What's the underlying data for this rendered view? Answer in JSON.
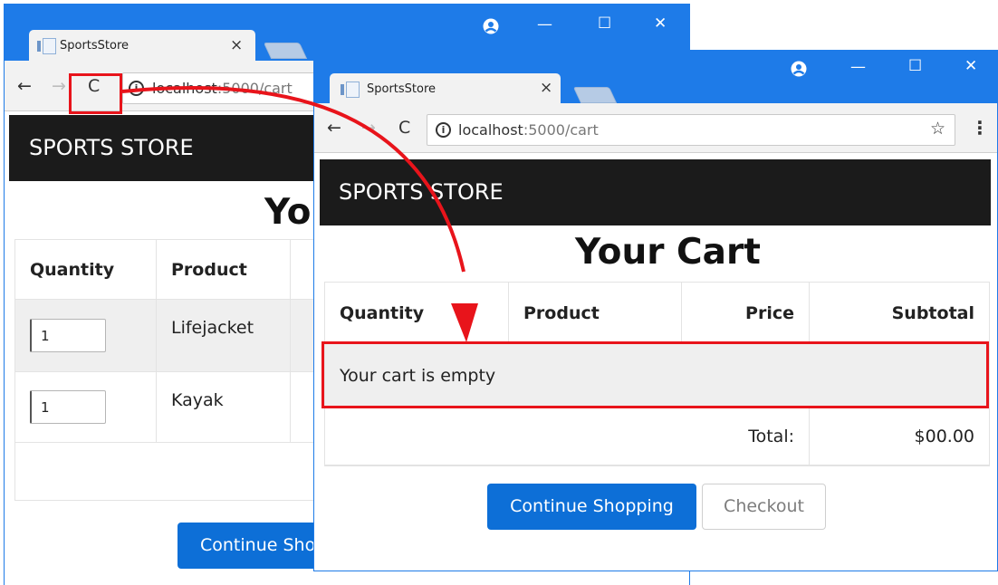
{
  "colors": {
    "titlebar": "#1e7be8",
    "navbar": "#1b1b1b",
    "primary_button": "#0d6fd7",
    "highlight": "#e8141b",
    "empty_row": "#efefef"
  },
  "back_window": {
    "tab": {
      "title": "SportsStore",
      "icon": "page-icon",
      "close": "×"
    },
    "controls": {
      "profile": "profile-icon",
      "minimize": "—",
      "maximize": "☐",
      "close": "✕"
    },
    "nav": {
      "back": "←",
      "forward": "→",
      "reload": "C"
    },
    "address": {
      "host": "localhost",
      "rest": ":5000/cart"
    },
    "brand": "SPORTS STORE",
    "heading_partial": "You",
    "table": {
      "headers": [
        "Quantity",
        "Product"
      ],
      "rows": [
        {
          "qty": "1",
          "product": "Lifejacket"
        },
        {
          "qty": "1",
          "product": "Kayak"
        }
      ]
    },
    "continue_partial": "Continue Sho"
  },
  "front_window": {
    "tab": {
      "title": "SportsStore",
      "icon": "page-icon",
      "close": "×"
    },
    "controls": {
      "profile": "profile-icon",
      "minimize": "—",
      "maximize": "☐",
      "close": "✕"
    },
    "nav": {
      "back": "←",
      "forward": "→",
      "reload": "C"
    },
    "address": {
      "host": "localhost",
      "rest": ":5000/cart"
    },
    "star": "☆",
    "menu": "⋮",
    "brand": "SPORTS STORE",
    "heading": "Your Cart",
    "table": {
      "headers": {
        "quantity": "Quantity",
        "product": "Product",
        "price": "Price",
        "subtotal": "Subtotal"
      },
      "empty_message": "Your cart is empty",
      "total_label": "Total:",
      "total_value": "$00.00"
    },
    "buttons": {
      "continue": "Continue Shopping",
      "checkout": "Checkout"
    }
  }
}
